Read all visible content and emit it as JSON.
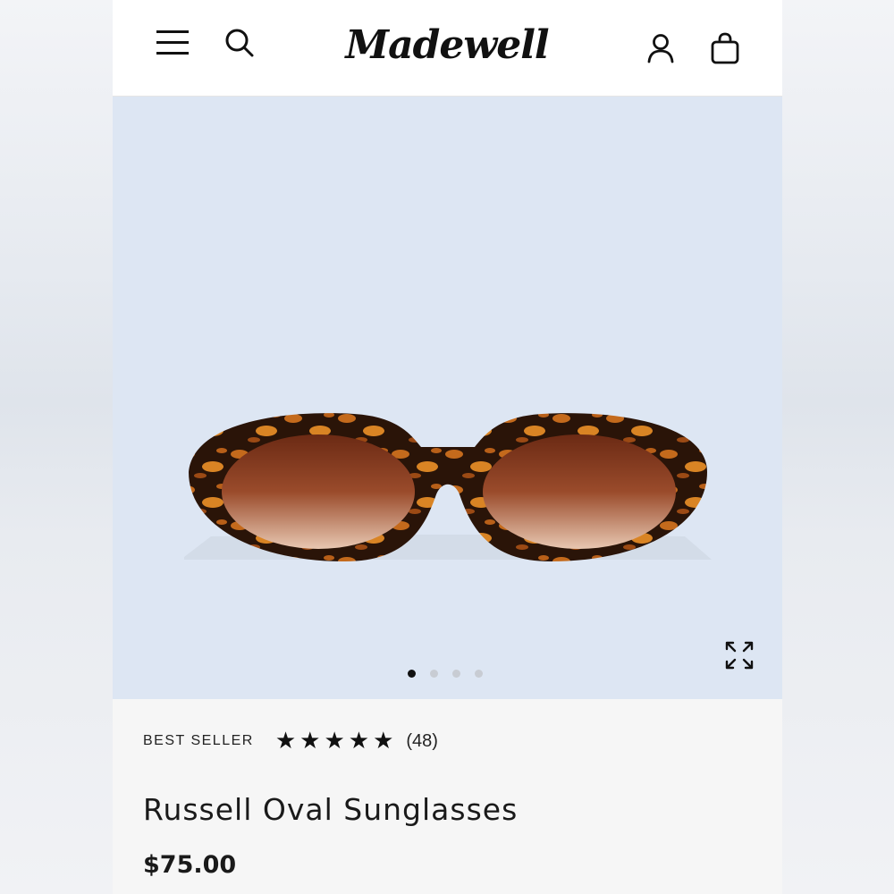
{
  "header": {
    "logo_text": "Madewell",
    "icons": {
      "menu": "hamburger-menu-icon",
      "search": "search-icon",
      "account": "account-icon",
      "bag": "shopping-bag-icon"
    }
  },
  "hero": {
    "image": "tortoiseshell-oval-sunglasses",
    "carousel": {
      "total": 4,
      "active": 1
    },
    "expand_icon": "expand-icon"
  },
  "product": {
    "badge": "BEST SELLER",
    "rating": 5,
    "review_count": "(48)",
    "title": "Russell Oval Sunglasses",
    "price": "$75.00"
  },
  "colors": {
    "hero_bg": "#dde6f3",
    "text": "#1a1a1a",
    "frame_dark": "#2a1408",
    "frame_light": "#c46a1c"
  }
}
